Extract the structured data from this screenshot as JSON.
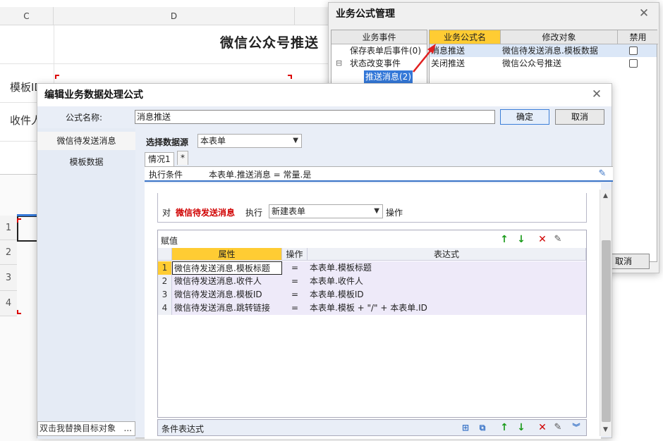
{
  "spreadsheet": {
    "col_c": "C",
    "col_d": "D",
    "title": "微信公众号推送",
    "label_template_id": "模板ID",
    "label_recipient": "收件人",
    "rows": [
      "1",
      "2",
      "3",
      "4"
    ]
  },
  "business_formula_dialog": {
    "title": "业务公式管理",
    "tree": {
      "header": "业务事件",
      "items": [
        {
          "label": "保存表单后事件(0)",
          "expander": ""
        },
        {
          "label": "状态改变事件",
          "expander": "⊟"
        },
        {
          "label": "推送消息(2)",
          "expander": "",
          "selected": true
        }
      ]
    },
    "table": {
      "headers": [
        "业务公式名",
        "修改对象",
        "禁用"
      ],
      "rows": [
        {
          "name": "消息推送",
          "target": "微信待发送消息.模板数据"
        },
        {
          "name": "关闭推送",
          "target": "微信公众号推送"
        }
      ]
    },
    "cancel_label": "取消"
  },
  "edit_dialog": {
    "title": "编辑业务数据处理公式",
    "formula_name_label": "公式名称:",
    "formula_name_value": "消息推送",
    "ok_label": "确定",
    "cancel_label": "取消",
    "left_items": [
      "微信待发送消息",
      "模板数据"
    ],
    "left_bottom_hint": "双击我替换目标对象",
    "left_bottom_more": "...",
    "source_label": "选择数据源",
    "source_value": "本表单",
    "tabs": [
      "情况1",
      "*"
    ],
    "condition_label": "执行条件",
    "condition_value": "本表单.推送消息 = 常量.是",
    "exec": {
      "to_label": "对",
      "target": "微信待发送消息",
      "exec_label": "执行",
      "action_value": "新建表单",
      "op_label": "操作"
    },
    "assign": {
      "title": "赋值",
      "headers": [
        "属性",
        "操作",
        "表达式"
      ],
      "rows": [
        {
          "n": "1",
          "prop": "微信待发送消息.模板标题",
          "op": "=",
          "expr": "本表单.模板标题"
        },
        {
          "n": "2",
          "prop": "微信待发送消息.收件人",
          "op": "=",
          "expr": "本表单.收件人"
        },
        {
          "n": "3",
          "prop": "微信待发送消息.模板ID",
          "op": "=",
          "expr": "本表单.模板ID"
        },
        {
          "n": "4",
          "prop": "微信待发送消息.跳转链接",
          "op": "=",
          "expr": "本表单.模板 + \"/\" + 本表单.ID"
        }
      ]
    },
    "cond_expr_label": "条件表达式"
  },
  "colors": {
    "accent": "#ffcc33",
    "highlight": "#d00000",
    "selection": "#3478d8"
  }
}
